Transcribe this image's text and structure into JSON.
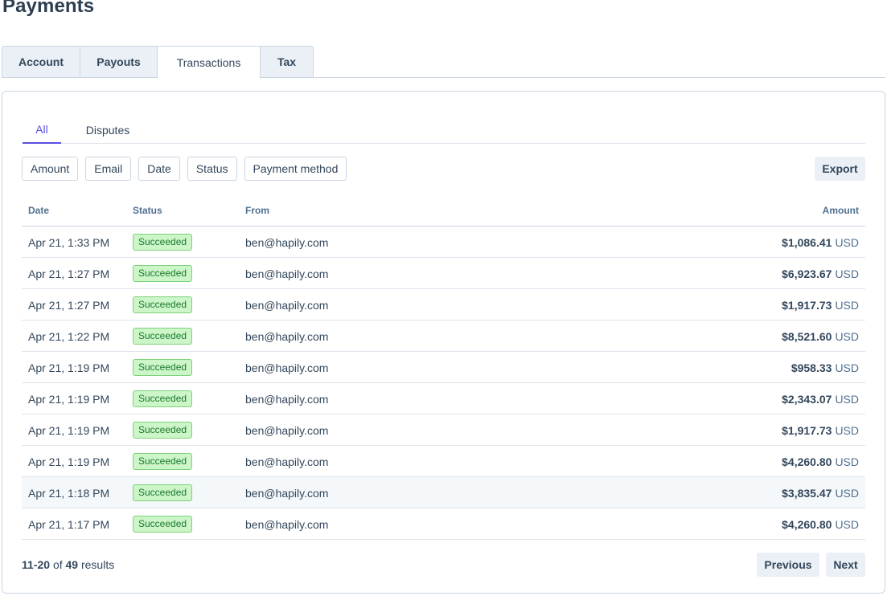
{
  "page": {
    "title": "Payments"
  },
  "tabs": [
    {
      "label": "Account"
    },
    {
      "label": "Payouts"
    },
    {
      "label": "Transactions",
      "active": true
    },
    {
      "label": "Tax"
    }
  ],
  "subtabs": [
    {
      "label": "All",
      "active": true
    },
    {
      "label": "Disputes"
    }
  ],
  "filters": [
    "Amount",
    "Email",
    "Date",
    "Status",
    "Payment method"
  ],
  "export_label": "Export",
  "table": {
    "headers": {
      "date": "Date",
      "status": "Status",
      "from": "From",
      "amount": "Amount"
    },
    "rows": [
      {
        "date": "Apr 21, 1:33 PM",
        "status": "Succeeded",
        "from": "ben@hapily.com",
        "amount": "$1,086.41",
        "currency": "USD"
      },
      {
        "date": "Apr 21, 1:27 PM",
        "status": "Succeeded",
        "from": "ben@hapily.com",
        "amount": "$6,923.67",
        "currency": "USD"
      },
      {
        "date": "Apr 21, 1:27 PM",
        "status": "Succeeded",
        "from": "ben@hapily.com",
        "amount": "$1,917.73",
        "currency": "USD"
      },
      {
        "date": "Apr 21, 1:22 PM",
        "status": "Succeeded",
        "from": "ben@hapily.com",
        "amount": "$8,521.60",
        "currency": "USD"
      },
      {
        "date": "Apr 21, 1:19 PM",
        "status": "Succeeded",
        "from": "ben@hapily.com",
        "amount": "$958.33",
        "currency": "USD"
      },
      {
        "date": "Apr 21, 1:19 PM",
        "status": "Succeeded",
        "from": "ben@hapily.com",
        "amount": "$2,343.07",
        "currency": "USD"
      },
      {
        "date": "Apr 21, 1:19 PM",
        "status": "Succeeded",
        "from": "ben@hapily.com",
        "amount": "$1,917.73",
        "currency": "USD"
      },
      {
        "date": "Apr 21, 1:19 PM",
        "status": "Succeeded",
        "from": "ben@hapily.com",
        "amount": "$4,260.80",
        "currency": "USD"
      },
      {
        "date": "Apr 21, 1:18 PM",
        "status": "Succeeded",
        "from": "ben@hapily.com",
        "amount": "$3,835.47",
        "currency": "USD"
      },
      {
        "date": "Apr 21, 1:17 PM",
        "status": "Succeeded",
        "from": "ben@hapily.com",
        "amount": "$4,260.80",
        "currency": "USD"
      }
    ]
  },
  "pagination": {
    "range": "11-20",
    "of_label": "of",
    "total": "49",
    "results_label": "results",
    "previous_label": "Previous",
    "next_label": "Next"
  },
  "colors": {
    "accent": "#5c4fe0",
    "badge_bg": "#ccf5c8",
    "badge_border": "#7fd17a",
    "text": "#33475b"
  }
}
